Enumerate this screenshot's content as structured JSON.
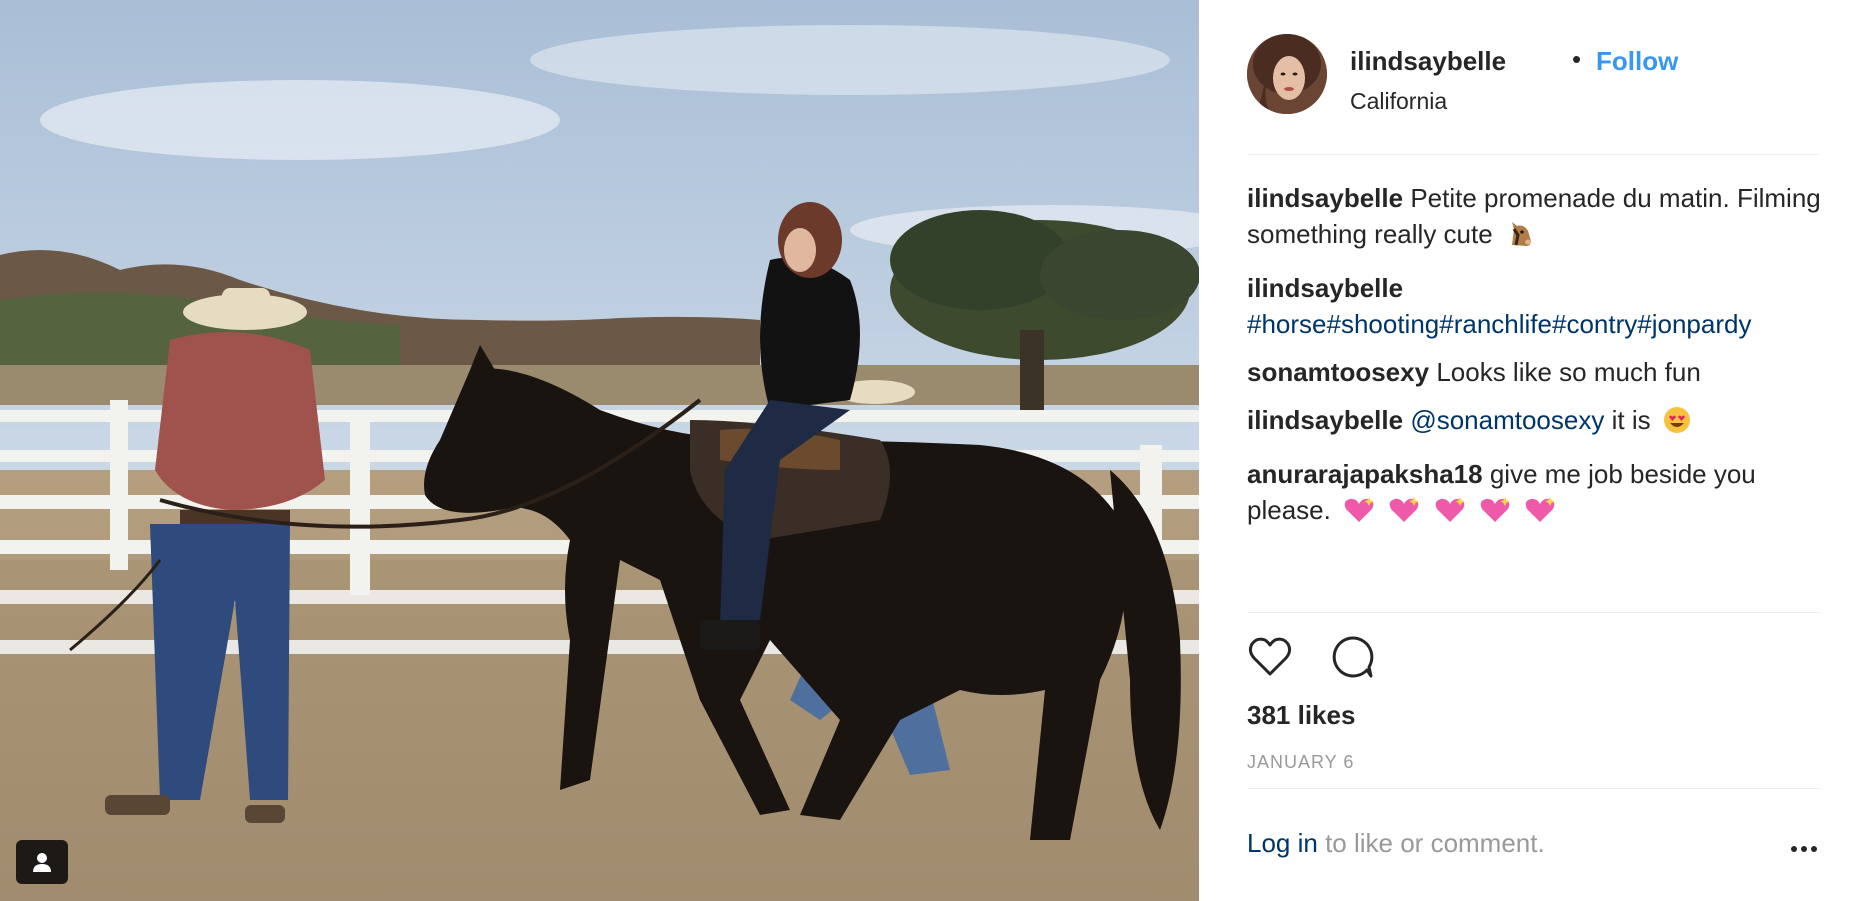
{
  "post": {
    "username": "ilindsaybelle",
    "separator": "•",
    "follow_label": "Follow",
    "location": "California"
  },
  "comments": [
    {
      "user": "ilindsaybelle",
      "text": "Petite promenade du matin. Filming something really cute",
      "emoji": "horse-face-emoji"
    },
    {
      "user": "ilindsaybelle",
      "text": "#horse#shooting#ranchlife#contry#jonpardy"
    },
    {
      "user": "sonamtoosexy",
      "text": "Looks like so much fun"
    },
    {
      "user": "ilindsaybelle",
      "mention": "@sonamtoosexy",
      "text": "it is",
      "emoji": "heart-eyes-emoji"
    },
    {
      "user": "anurarajapaksha18",
      "text": "give me job beside you please.",
      "emoji": "sparkling-heart-emoji"
    }
  ],
  "likes": "381 likes",
  "date": "JANUARY 6",
  "login": {
    "link": "Log in",
    "text": "to like or comment."
  },
  "icons": {
    "like": "heart-outline-icon",
    "comment": "speech-bubble-icon",
    "more": "ellipsis-icon",
    "tag": "user-tag-icon"
  },
  "colors": {
    "follow": "#3897f0",
    "hashtag": "#003569",
    "muted": "#999999",
    "text": "#262626"
  }
}
